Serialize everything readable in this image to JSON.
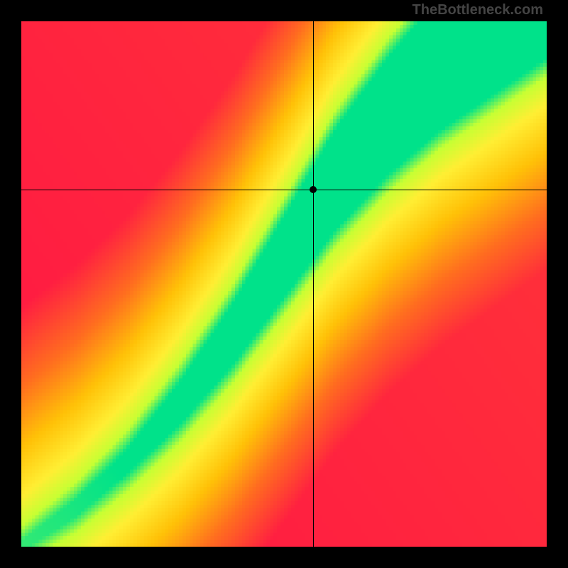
{
  "watermark": "TheBottleneck.com",
  "chart_data": {
    "type": "heatmap",
    "title": "",
    "xlabel": "",
    "ylabel": "",
    "xlim": [
      0,
      1
    ],
    "ylim": [
      0,
      1
    ],
    "grid_size": 150,
    "crosshair": {
      "x": 0.555,
      "y": 0.68
    },
    "ridge_points": [
      {
        "x": 0.0,
        "y": 0.0
      },
      {
        "x": 0.1,
        "y": 0.07
      },
      {
        "x": 0.2,
        "y": 0.16
      },
      {
        "x": 0.3,
        "y": 0.27
      },
      {
        "x": 0.4,
        "y": 0.4
      },
      {
        "x": 0.5,
        "y": 0.55
      },
      {
        "x": 0.6,
        "y": 0.7
      },
      {
        "x": 0.7,
        "y": 0.82
      },
      {
        "x": 0.8,
        "y": 0.92
      },
      {
        "x": 0.9,
        "y": 1.0
      },
      {
        "x": 1.0,
        "y": 1.08
      }
    ],
    "band_halfwidth_points": [
      {
        "x": 0.0,
        "w": 0.01
      },
      {
        "x": 0.2,
        "w": 0.022
      },
      {
        "x": 0.4,
        "w": 0.045
      },
      {
        "x": 0.6,
        "w": 0.07
      },
      {
        "x": 0.8,
        "w": 0.09
      },
      {
        "x": 1.0,
        "w": 0.105
      }
    ],
    "color_stops": [
      {
        "t": 0.0,
        "color": "#ff1744"
      },
      {
        "t": 0.35,
        "color": "#ff6d1f"
      },
      {
        "t": 0.6,
        "color": "#ffc107"
      },
      {
        "t": 0.8,
        "color": "#ffee33"
      },
      {
        "t": 0.92,
        "color": "#c6ff33"
      },
      {
        "t": 1.0,
        "color": "#00e28a"
      }
    ]
  }
}
